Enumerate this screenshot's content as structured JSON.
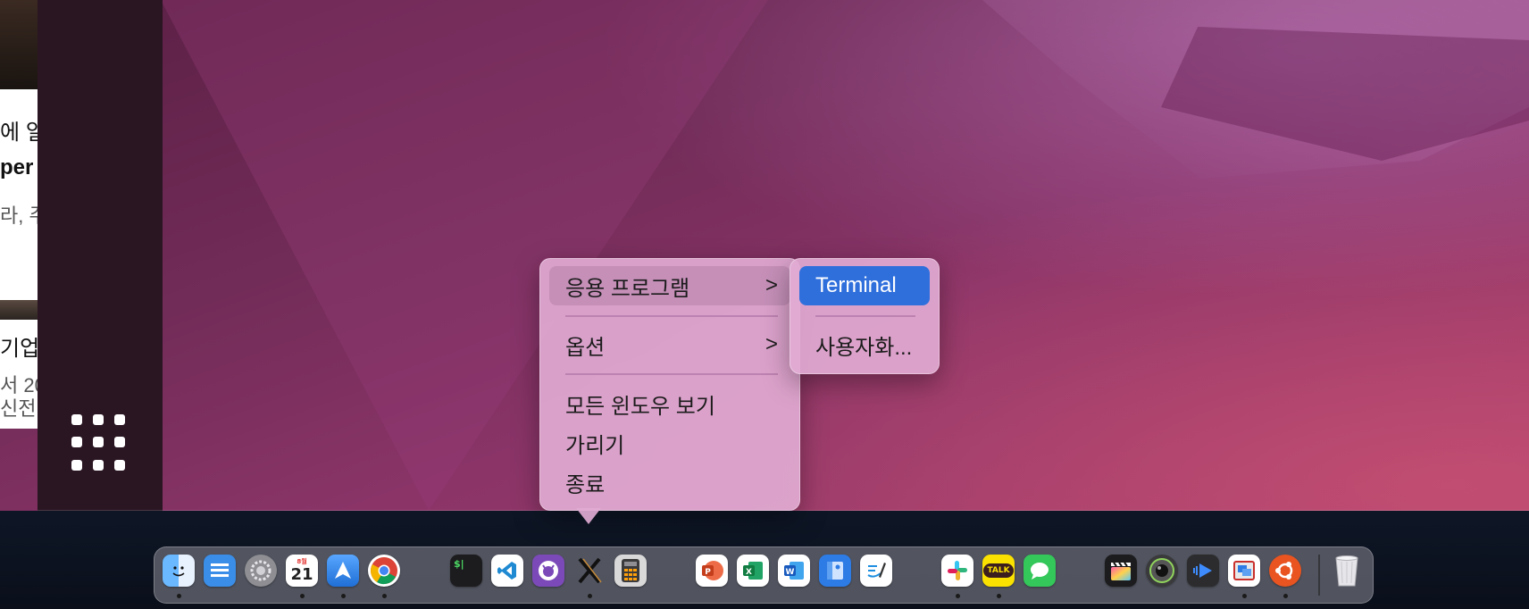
{
  "left_panel": {
    "line1": "에 일",
    "line2": "per",
    "line3": "라, 주",
    "line4": "기업",
    "line5": "서 20",
    "line6": "신전"
  },
  "context_menu": {
    "items": [
      {
        "label": "응용 프로그램",
        "has_submenu": true
      },
      {
        "label": "옵션",
        "has_submenu": true
      },
      {
        "label": "모든 윈도우 보기",
        "has_submenu": false
      },
      {
        "label": "가리기",
        "has_submenu": false
      },
      {
        "label": "종료",
        "has_submenu": false
      }
    ],
    "chevron": ">"
  },
  "submenu": {
    "items": [
      {
        "label": "Terminal",
        "selected": true
      },
      {
        "label": "사용자화...",
        "selected": false
      }
    ]
  },
  "dock": {
    "calendar_day": "21",
    "calendar_month": "8월",
    "kakaotalk_label": "TALK",
    "terminal_glyph": "$|",
    "items": [
      {
        "name": "finder",
        "running": true
      },
      {
        "name": "files",
        "running": false
      },
      {
        "name": "system-settings",
        "running": false
      },
      {
        "name": "calendar",
        "running": true
      },
      {
        "name": "spark-mail",
        "running": true
      },
      {
        "name": "chrome",
        "running": true
      },
      {
        "name": "terminal",
        "running": false
      },
      {
        "name": "vscode",
        "running": false
      },
      {
        "name": "github-desktop",
        "running": false
      },
      {
        "name": "xquartz",
        "running": true
      },
      {
        "name": "calculator",
        "running": false
      },
      {
        "name": "powerpoint",
        "running": false
      },
      {
        "name": "excel",
        "running": false
      },
      {
        "name": "word",
        "running": false
      },
      {
        "name": "notes-app",
        "running": false
      },
      {
        "name": "freeform",
        "running": false
      },
      {
        "name": "slack",
        "running": true
      },
      {
        "name": "kakaotalk",
        "running": true
      },
      {
        "name": "messages",
        "running": false
      },
      {
        "name": "final-cut-pro",
        "running": false
      },
      {
        "name": "camera-app",
        "running": false
      },
      {
        "name": "video-app",
        "running": false
      },
      {
        "name": "parallels",
        "running": true
      },
      {
        "name": "ubuntu",
        "running": true
      },
      {
        "name": "trash",
        "running": false
      }
    ]
  }
}
